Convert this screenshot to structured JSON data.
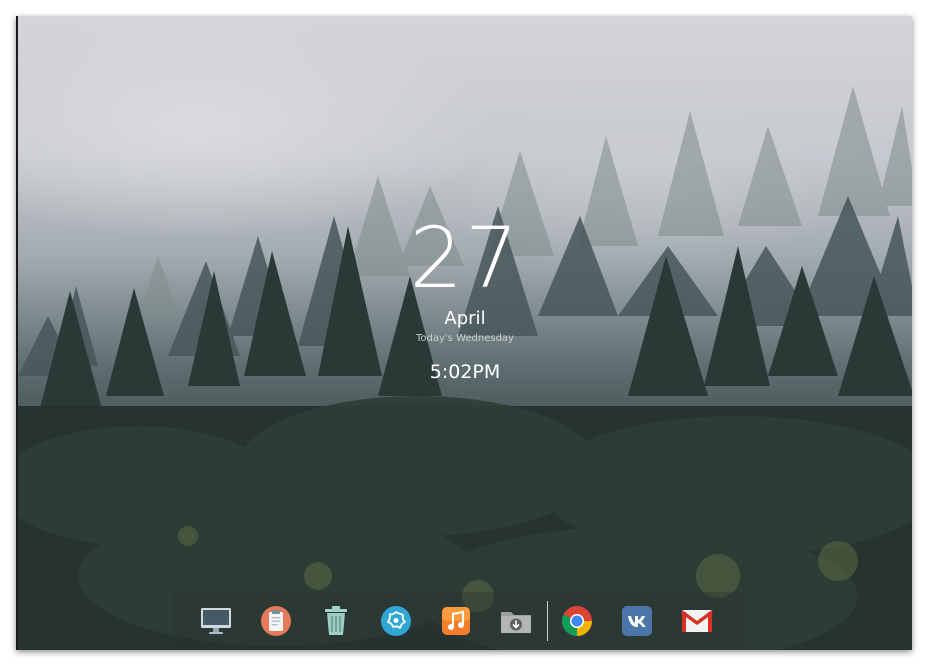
{
  "clock": {
    "day": "27",
    "month": "April",
    "weekday_text": "Today's Wednesday",
    "time": "5:02PM"
  },
  "dock": {
    "apps": [
      {
        "icon": "monitor-icon"
      },
      {
        "icon": "clipboard-icon"
      },
      {
        "icon": "trash-icon"
      },
      {
        "icon": "settings-flower-icon"
      },
      {
        "icon": "music-icon"
      },
      {
        "icon": "download-folder-icon"
      },
      {
        "icon": "chrome-icon"
      },
      {
        "icon": "vk-icon"
      },
      {
        "icon": "gmail-icon"
      }
    ]
  },
  "colors": {
    "dock_bg": "rgba(40,48,48,0.35)",
    "text": "#ffffff"
  }
}
